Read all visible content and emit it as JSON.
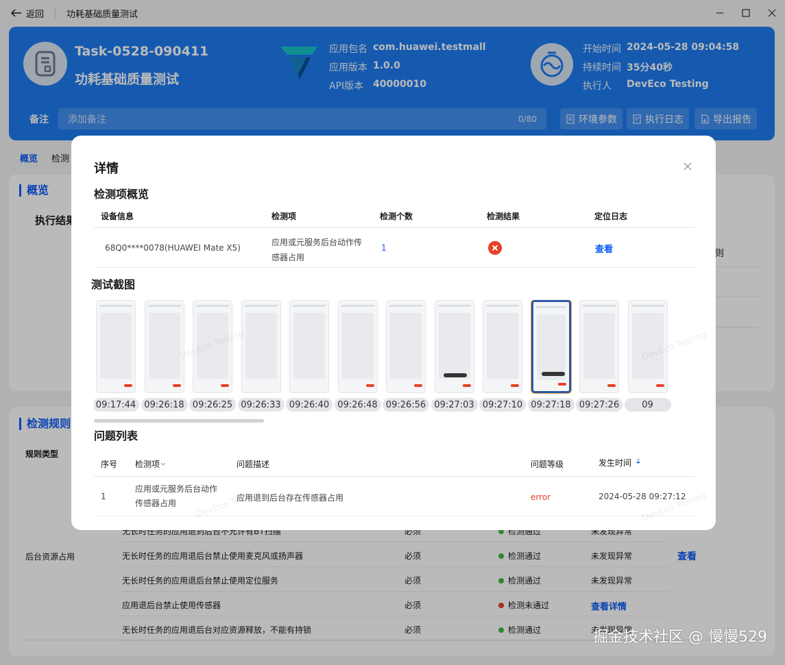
{
  "window": {
    "back_label": "返回",
    "title": "功耗基础质量测试"
  },
  "header": {
    "task_id": "Task-0528-090411",
    "task_name": "功耗基础质量测试",
    "package_label": "应用包名",
    "package": "com.huawei.testmall",
    "version_label": "应用版本",
    "version": "1.0.0",
    "api_label": "API版本",
    "api": "40000010",
    "start_label": "开始时间",
    "start": "2024-05-28 09:04:58",
    "duration_label": "持续时间",
    "duration": "35分40秒",
    "executor_label": "执行人",
    "executor": "DevEco Testing",
    "note_label": "备注",
    "note_placeholder": "添加备注",
    "note_count": "0/80",
    "btn_env": "环境参数",
    "btn_log": "执行日志",
    "btn_export": "导出报告"
  },
  "tabs": [
    "概览",
    "检测"
  ],
  "overview": {
    "title": "概览",
    "exec_label": "执行结果",
    "rule_fragment": "则"
  },
  "rules": {
    "title": "检测规则",
    "type_header": "规则类型",
    "category": "后台资源占用",
    "view_link": "查看",
    "rows": [
      {
        "name": "无长时任务的应用退到后台不允许有BT扫描",
        "req": "必须",
        "status": "检测通过",
        "result": "未发现异常",
        "ok": true
      },
      {
        "name": "无长时任务的应用退后台禁止使用麦克风或扬声器",
        "req": "必须",
        "status": "检测通过",
        "result": "未发现异常",
        "ok": true
      },
      {
        "name": "无长时任务的应用退后台禁止使用定位服务",
        "req": "必须",
        "status": "检测通过",
        "result": "未发现异常",
        "ok": true
      },
      {
        "name": "应用退后台禁止使用传感器",
        "req": "必须",
        "status": "检测未通过",
        "result": "查看详情",
        "ok": false
      },
      {
        "name": "无长时任务的应用退后台对应资源释放，不能有持锁",
        "req": "必须",
        "status": "检测通过",
        "result": "未发现异常",
        "ok": true
      }
    ]
  },
  "modal": {
    "title": "详情",
    "overview_title": "检测项概览",
    "headers": {
      "device": "设备信息",
      "item": "检测项",
      "count": "检测个数",
      "result": "检测结果",
      "log": "定位日志"
    },
    "row": {
      "device": "68Q0****0078(HUAWEI Mate X5)",
      "item_line1": "应用或元服务后台动作传",
      "item_line2": "感器占用",
      "count": "1",
      "log": "查看"
    },
    "shots_title": "测试截图",
    "shot_times": [
      "09:17:44",
      "09:26:18",
      "09:26:25",
      "09:26:33",
      "09:26:40",
      "09:26:48",
      "09:26:56",
      "09:27:03",
      "09:27:10",
      "09:27:18",
      "09:27:26",
      "09"
    ],
    "issues_title": "问题列表",
    "issue_headers": {
      "no": "序号",
      "item": "检测项",
      "desc": "问题描述",
      "level": "问题等级",
      "time": "发生时间"
    },
    "issue": {
      "no": "1",
      "item_line1": "应用或元服务后台动作",
      "item_line2": "传感器占用",
      "desc": "应用退到后台存在传感器占用",
      "level": "error",
      "time": "2024-05-28  09:27:12"
    }
  },
  "watermark": "DevEco Testing",
  "footer_watermark": "掘金技术社区 @ 慢慢529",
  "colors": {
    "primary": "#1e7cf0",
    "link": "#0a59f7",
    "error": "#e84026",
    "pass": "#41ba41"
  }
}
